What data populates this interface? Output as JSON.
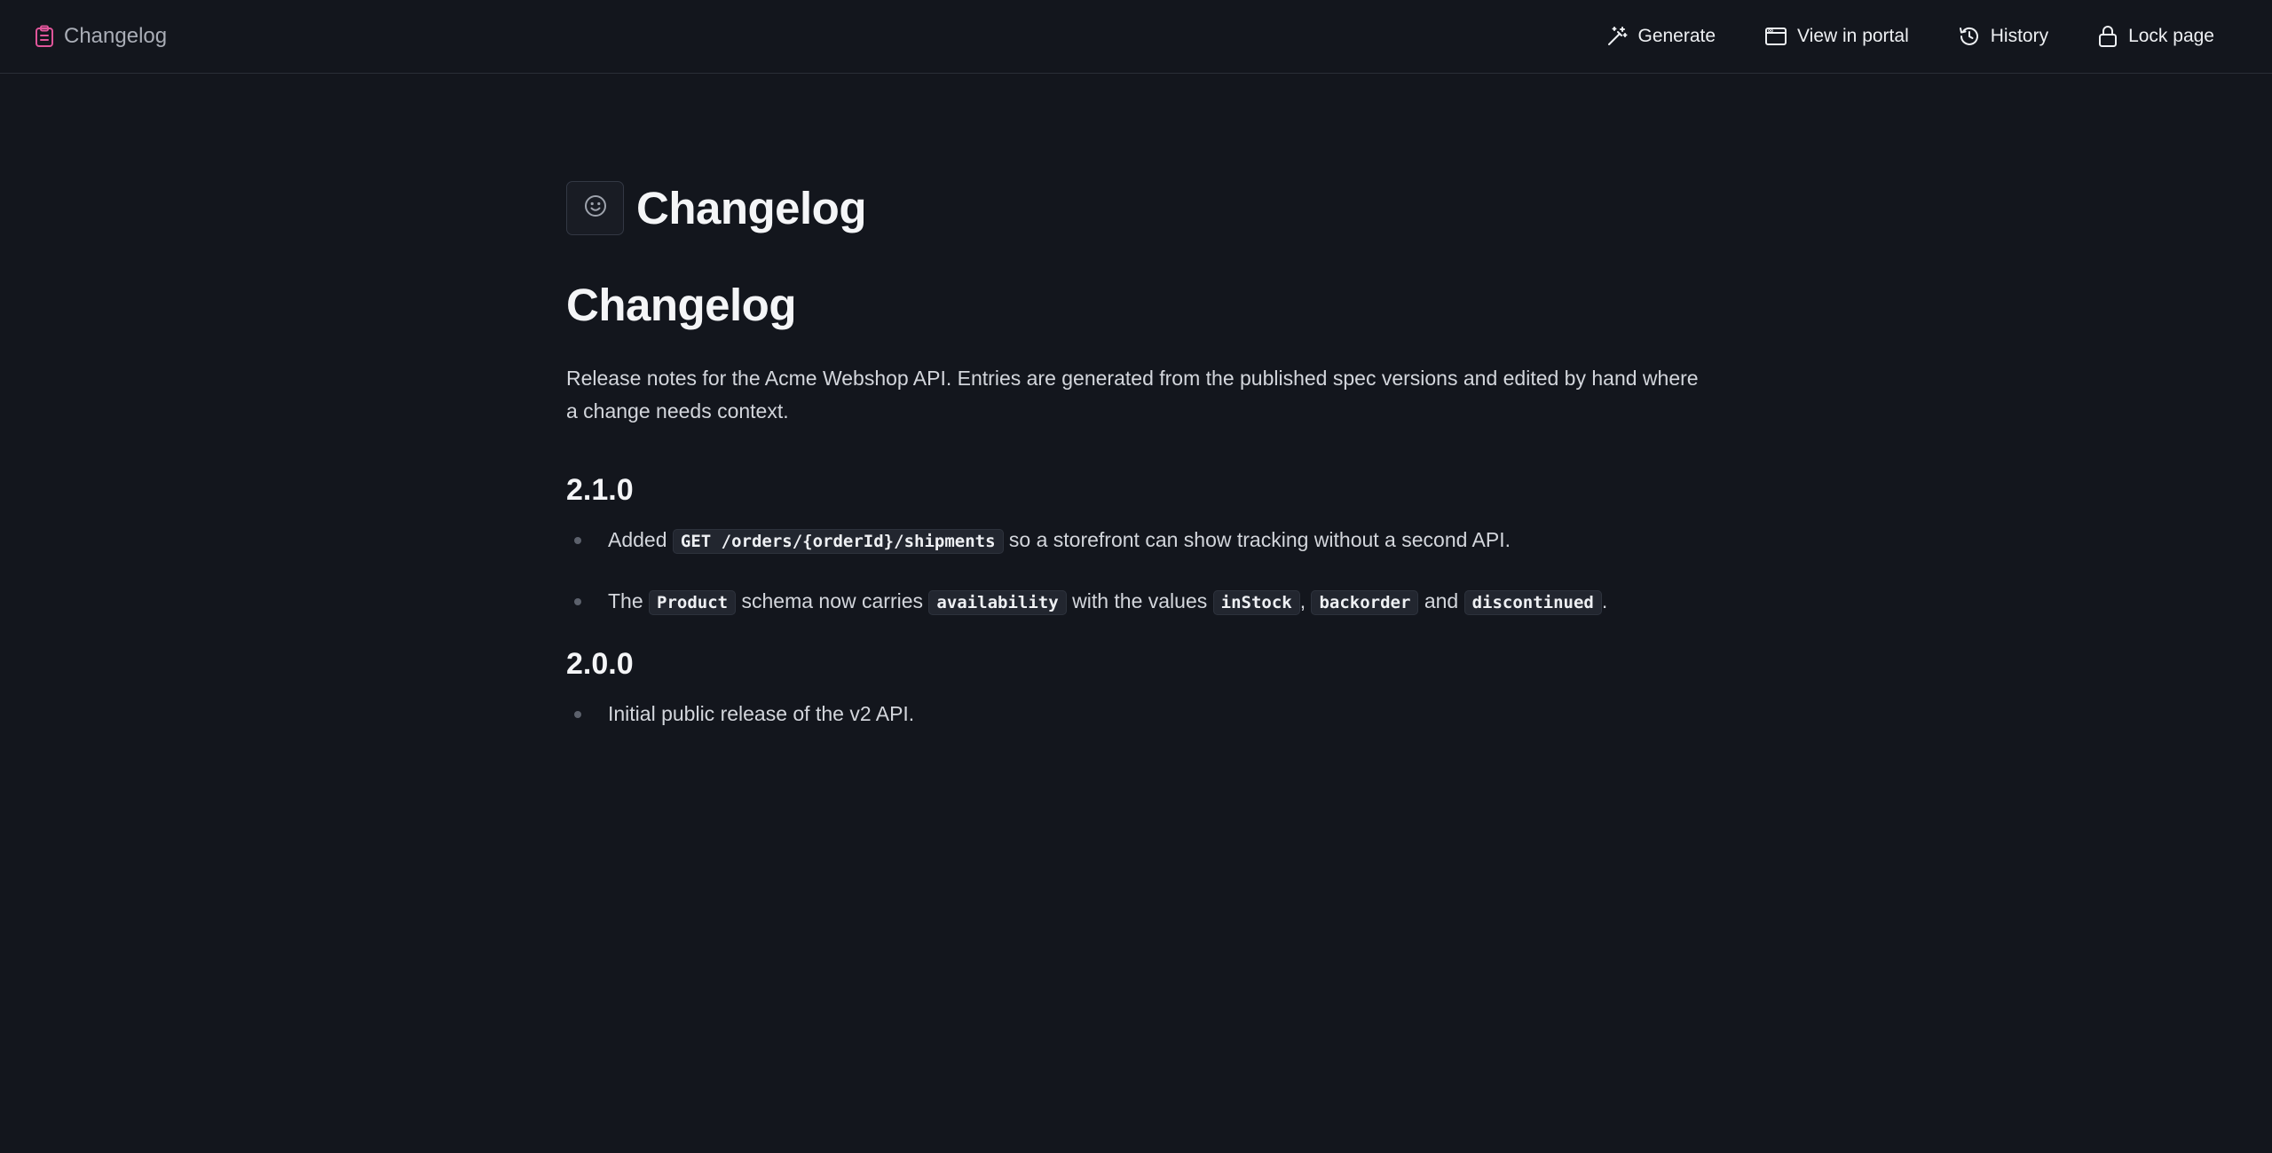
{
  "topbar": {
    "breadcrumb_label": "Changelog",
    "breadcrumb_icon": "clipboard-icon",
    "accent_color": "#e0559a",
    "actions": [
      {
        "label": "Generate",
        "icon": "magic-wand-icon"
      },
      {
        "label": "View in portal",
        "icon": "browser-window-icon"
      },
      {
        "label": "History",
        "icon": "history-icon"
      },
      {
        "label": "Lock page",
        "icon": "lock-icon"
      }
    ]
  },
  "page": {
    "emoji_icon": "smiley-icon",
    "title": "Changelog",
    "heading": "Changelog",
    "intro": "Release notes for the Acme Webshop API. Entries are generated from the published spec versions and edited by hand where a change needs context.",
    "versions": [
      {
        "version": "2.1.0",
        "items": [
          {
            "t1": "Added",
            "c1": "GET /orders/{orderId}/shipments",
            "t2": "so a storefront can show tracking without a second API."
          },
          {
            "t1": "The",
            "c1": "Product",
            "t2": "schema now carries",
            "c2": "availability",
            "t3": "with the values",
            "c3": "inStock",
            "t4": ",",
            "c4": "backorder",
            "t5": "and",
            "c5": "discontinued",
            "t6": "."
          }
        ]
      },
      {
        "version": "2.0.0",
        "items": [
          {
            "t1": "Initial public release of the v2 API."
          }
        ]
      }
    ]
  }
}
